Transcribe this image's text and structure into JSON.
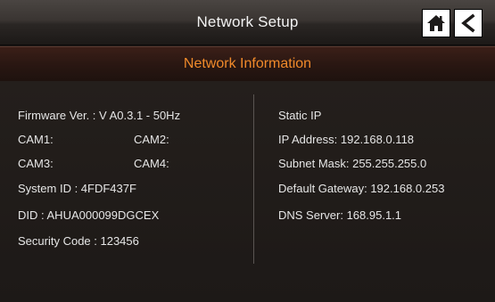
{
  "header": {
    "title": "Network Setup",
    "home_icon": "home-icon",
    "back_icon": "back-arrow-icon"
  },
  "section": {
    "title": "Network Information"
  },
  "left_info": {
    "firmware": "Firmware Ver. : V A0.3.1 - 50Hz",
    "cam1": "CAM1:",
    "cam2": "CAM2:",
    "cam3": "CAM3:",
    "cam4": "CAM4:",
    "system_id": "System ID : 4FDF437F",
    "did": "DID : AHUA000099DGCEX",
    "security_code": "Security Code : 123456"
  },
  "right_info": {
    "mode": "Static IP",
    "ip_address": "IP Address: 192.168.0.118",
    "subnet_mask": "Subnet Mask: 255.255.255.0",
    "default_gateway": "Default Gateway: 192.168.0.253",
    "dns_server": "DNS Server: 168.95.1.1"
  },
  "colors": {
    "section_title": "#f08a2a",
    "text": "#e6e6e6",
    "background": "#1e1916"
  }
}
